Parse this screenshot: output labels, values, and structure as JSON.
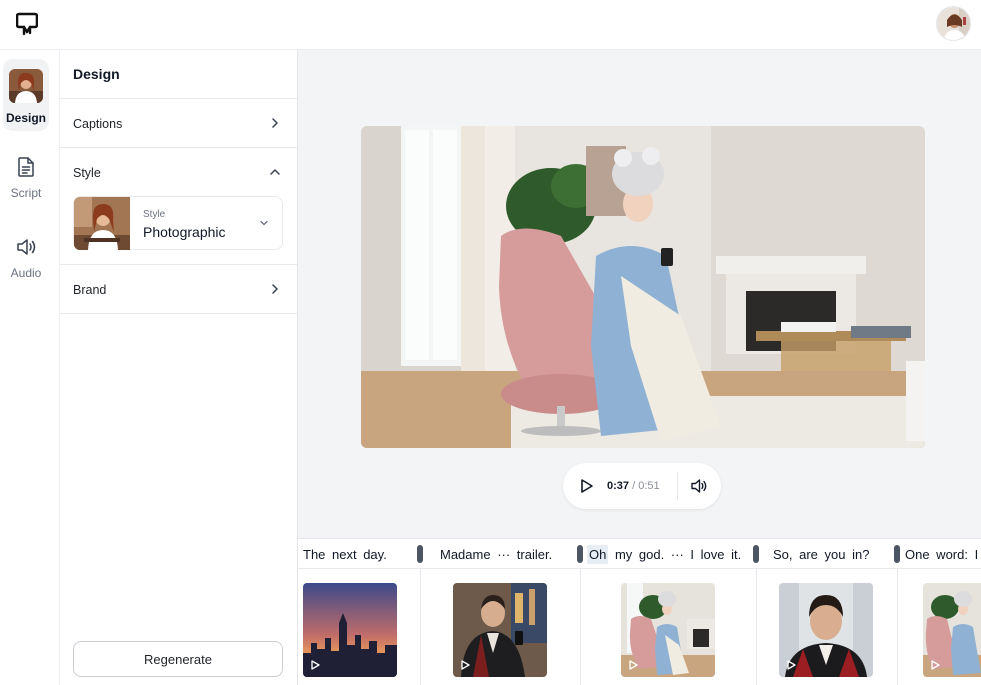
{
  "app": {
    "logo_icon": "brand-logo-icon",
    "avatar_icon": "user-avatar"
  },
  "rail": {
    "items": [
      {
        "label": "Design",
        "icon": "design-thumbnail",
        "active": true
      },
      {
        "label": "Script",
        "icon": "document-icon",
        "active": false
      },
      {
        "label": "Audio",
        "icon": "speaker-icon",
        "active": false
      }
    ]
  },
  "panel": {
    "title": "Design",
    "captions_label": "Captions",
    "style_label": "Style",
    "style_card": {
      "caption": "Style",
      "value": "Photographic"
    },
    "brand_label": "Brand",
    "regenerate_label": "Regenerate"
  },
  "player": {
    "current_time": "0:37",
    "separator": " / ",
    "duration": "0:51",
    "play_icon": "play-icon",
    "volume_icon": "speaker-icon"
  },
  "timeline": {
    "segments": [
      {
        "caption": "The next day."
      },
      {
        "caption": "Madame ··· trailer."
      },
      {
        "caption_highlight": "Oh",
        "caption_rest": " my god. ··· I love it."
      },
      {
        "caption": "So, are you in?"
      },
      {
        "caption": "One word: I"
      }
    ]
  },
  "colors": {
    "accent_dark": "#4b5563",
    "main_bg": "#f3f4f6",
    "highlight": "#e7edf5"
  }
}
